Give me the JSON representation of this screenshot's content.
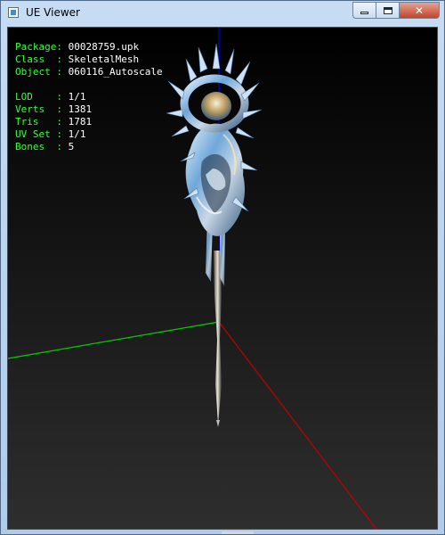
{
  "window": {
    "title": "UE Viewer"
  },
  "caption_buttons": {
    "minimize": "minimize",
    "maximize": "maximize",
    "close": "✕"
  },
  "info": {
    "rows_top": [
      {
        "label": "Package: ",
        "value": "00028759.upk"
      },
      {
        "label": "Class  : ",
        "value": "SkeletalMesh"
      },
      {
        "label": "Object : ",
        "value": "060116_Autoscale"
      }
    ],
    "rows_bottom": [
      {
        "label": "LOD    : ",
        "value": "1/1"
      },
      {
        "label": "Verts  : ",
        "value": "1381"
      },
      {
        "label": "Tris   : ",
        "value": "1781"
      },
      {
        "label": "UV Set : ",
        "value": "1/1"
      },
      {
        "label": "Bones  : ",
        "value": "5"
      }
    ]
  },
  "colors": {
    "axis_x": "#c00000",
    "axis_y": "#00d000",
    "axis_z": "#0000e0",
    "label": "#33ff33",
    "value": "#ffffff"
  }
}
